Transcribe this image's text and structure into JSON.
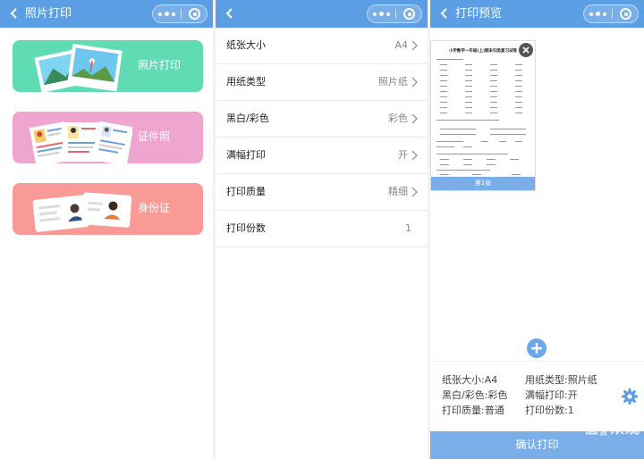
{
  "panel1": {
    "title": "照片打印",
    "cards": [
      {
        "label": "照片打印",
        "color": "#5fdcb4"
      },
      {
        "label": "证件照",
        "color": "#eea6cf"
      },
      {
        "label": "身份证",
        "color": "#f99a97"
      }
    ]
  },
  "panel2": {
    "title": "",
    "rows": [
      {
        "label": "纸张大小",
        "value": "A4"
      },
      {
        "label": "用纸类型",
        "value": "照片纸"
      },
      {
        "label": "黑白/彩色",
        "value": "彩色"
      },
      {
        "label": "满幅打印",
        "value": "开"
      },
      {
        "label": "打印质量",
        "value": "精细"
      },
      {
        "label": "打印份数",
        "value": "1"
      }
    ]
  },
  "panel3": {
    "title": "打印预览",
    "doc_title": "小学数学一年级(上)期末归类复习试卷",
    "page_label": "第1张",
    "info": {
      "paper_size": "纸张大小:A4",
      "paper_type": "用纸类型:照片纸",
      "color": "黑白/彩色:彩色",
      "full_bleed": "满幅打印:开",
      "quality": "打印质量:普通",
      "copies": "打印份数:1"
    },
    "confirm_label": "确认打印"
  },
  "watermark": {
    "main": "值",
    "side": "新浪",
    "tail": "众观"
  },
  "colors": {
    "navbar": "#5b9ee3",
    "accent": "#7aaee8"
  }
}
